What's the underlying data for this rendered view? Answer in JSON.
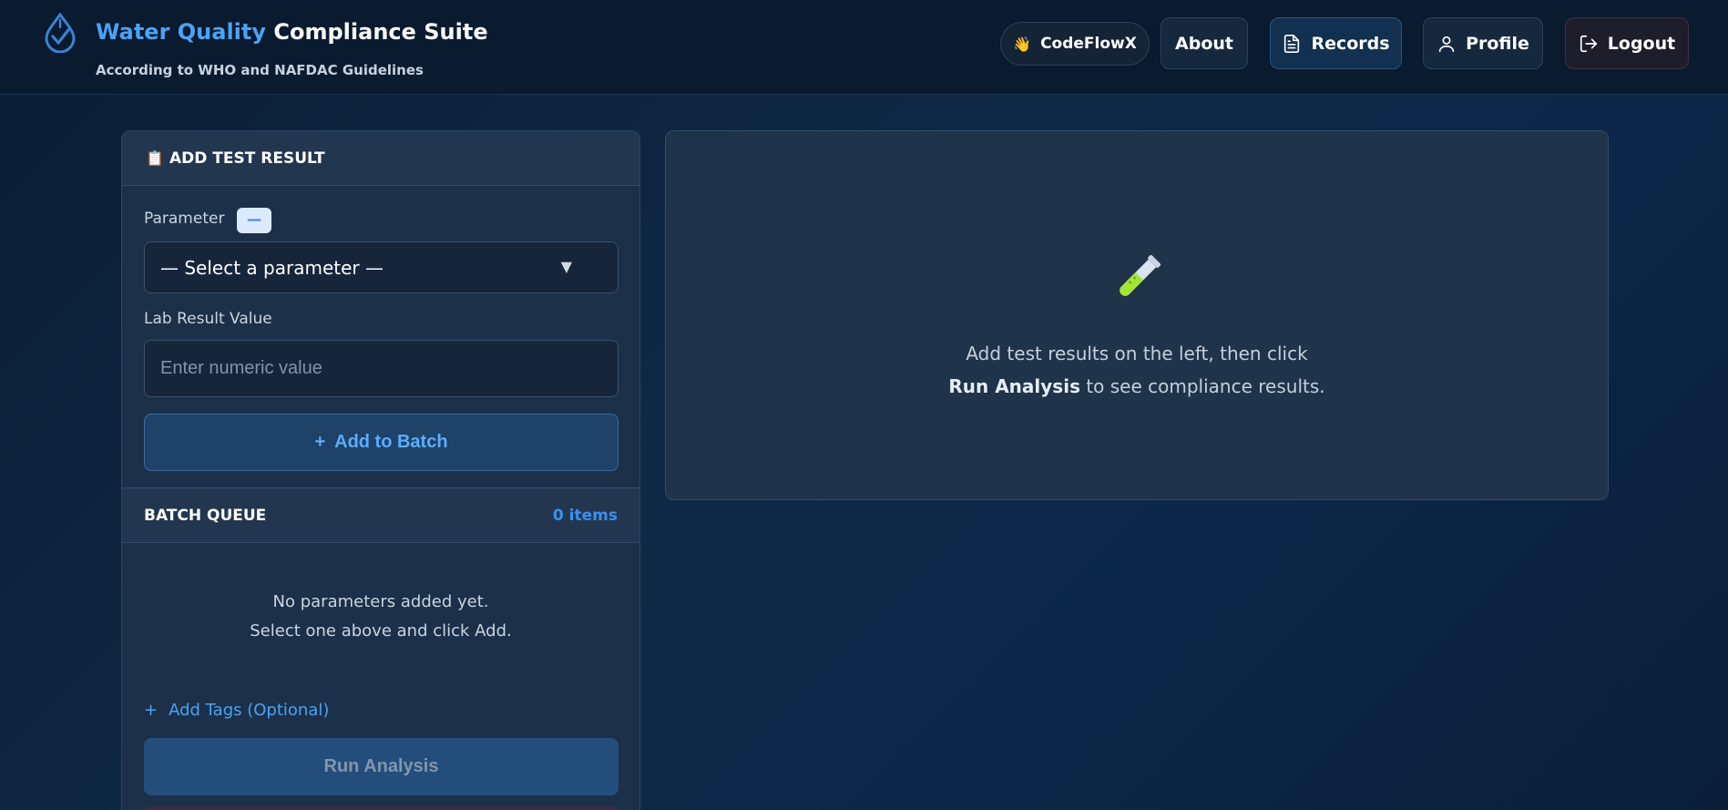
{
  "header": {
    "title_accent": "Water Quality",
    "title_rest": "Compliance Suite",
    "subtitle": "According to WHO and NAFDAC Guidelines",
    "nav": {
      "user_label": "CodeFlowX",
      "user_emoji": "👋",
      "about_label": "About",
      "records_label": "Records",
      "profile_label": "Profile",
      "logout_label": "Logout"
    }
  },
  "add_test": {
    "header_emoji": "📋",
    "header": "ADD TEST RESULT",
    "parameter_label": "Parameter",
    "parameter_badge": "—",
    "select_value": "— Select a parameter —",
    "select_caret": "▼",
    "lab_label": "Lab Result Value",
    "lab_placeholder": "Enter numeric value",
    "add_batch_plus": "+",
    "add_batch_label": "Add to Batch"
  },
  "batch_queue": {
    "title": "BATCH QUEUE",
    "count": "0 items",
    "empty_line1": "No parameters added yet.",
    "empty_line2": "Select one above and click Add."
  },
  "tags": {
    "plus": "+",
    "label": "Add Tags (Optional)"
  },
  "run": {
    "label": "Run Analysis"
  },
  "results": {
    "line1": "Add test results on the left, then click",
    "line2_bold": "Run Analysis",
    "line2_rest": " to see compliance results."
  },
  "colors": {
    "accent": "#4aa3f5",
    "background": "#0f2a47",
    "card": "#1d3049"
  },
  "icons": [
    "water-drop-logo-icon",
    "wave-icon",
    "document-icon",
    "user-icon",
    "logout-icon",
    "clipboard-icon",
    "test-tube-icon"
  ]
}
